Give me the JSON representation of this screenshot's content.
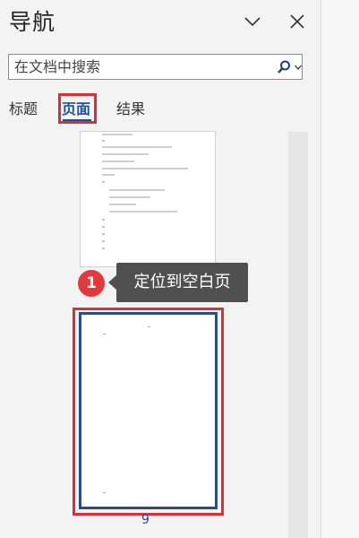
{
  "pane": {
    "title": "导航",
    "collapse_icon": "chevron-down-icon",
    "close_icon": "close-icon"
  },
  "search": {
    "placeholder": "在文档中搜索",
    "value": "",
    "icon": "search-icon",
    "dropdown_icon": "chevron-down-icon"
  },
  "tabs": {
    "headings": "标题",
    "pages": "页面",
    "results": "结果",
    "active": "pages"
  },
  "thumbnails": [
    {
      "state": "normal"
    },
    {
      "state": "selected",
      "page_number": "9"
    }
  ],
  "callout": {
    "number": "1",
    "text": "定位到空白页"
  },
  "colors": {
    "accent_blue": "#1f4e9a",
    "highlight_red": "#d93035",
    "badge_red": "#e03a3e",
    "callout_bg": "#505050",
    "page_border": "#2b4d80"
  }
}
